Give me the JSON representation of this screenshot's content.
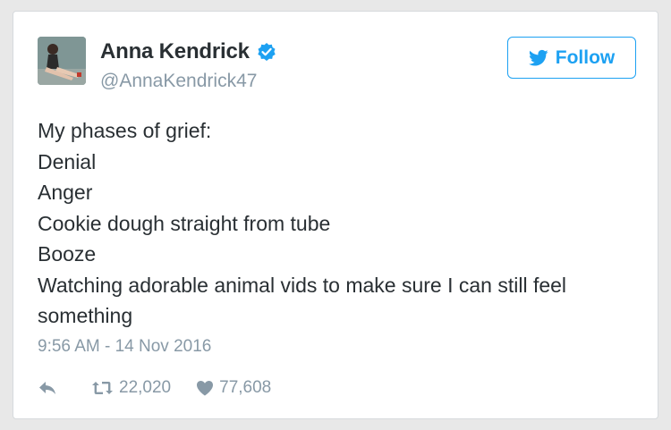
{
  "user": {
    "name": "Anna Kendrick",
    "handle": "@AnnaKendrick47",
    "avatar_icon": "profile-photo",
    "verified_icon": "verified-badge-icon"
  },
  "follow_button": {
    "label": "Follow",
    "icon": "twitter-bird-icon"
  },
  "tweet": {
    "lines": [
      "My phases of grief:",
      "Denial",
      "Anger",
      "Cookie dough straight from tube",
      "Booze",
      "Watching adorable animal vids to make sure I can still feel",
      "something"
    ],
    "timestamp": "9:56 AM - 14 Nov 2016"
  },
  "actions": {
    "reply_icon": "reply-icon",
    "retweet_icon": "retweet-icon",
    "retweet_count": "22,020",
    "like_icon": "heart-icon",
    "like_count": "77,608"
  },
  "colors": {
    "accent": "#1da1f2",
    "text": "#292f33",
    "muted": "#8899a6",
    "border": "#d6dadd"
  }
}
